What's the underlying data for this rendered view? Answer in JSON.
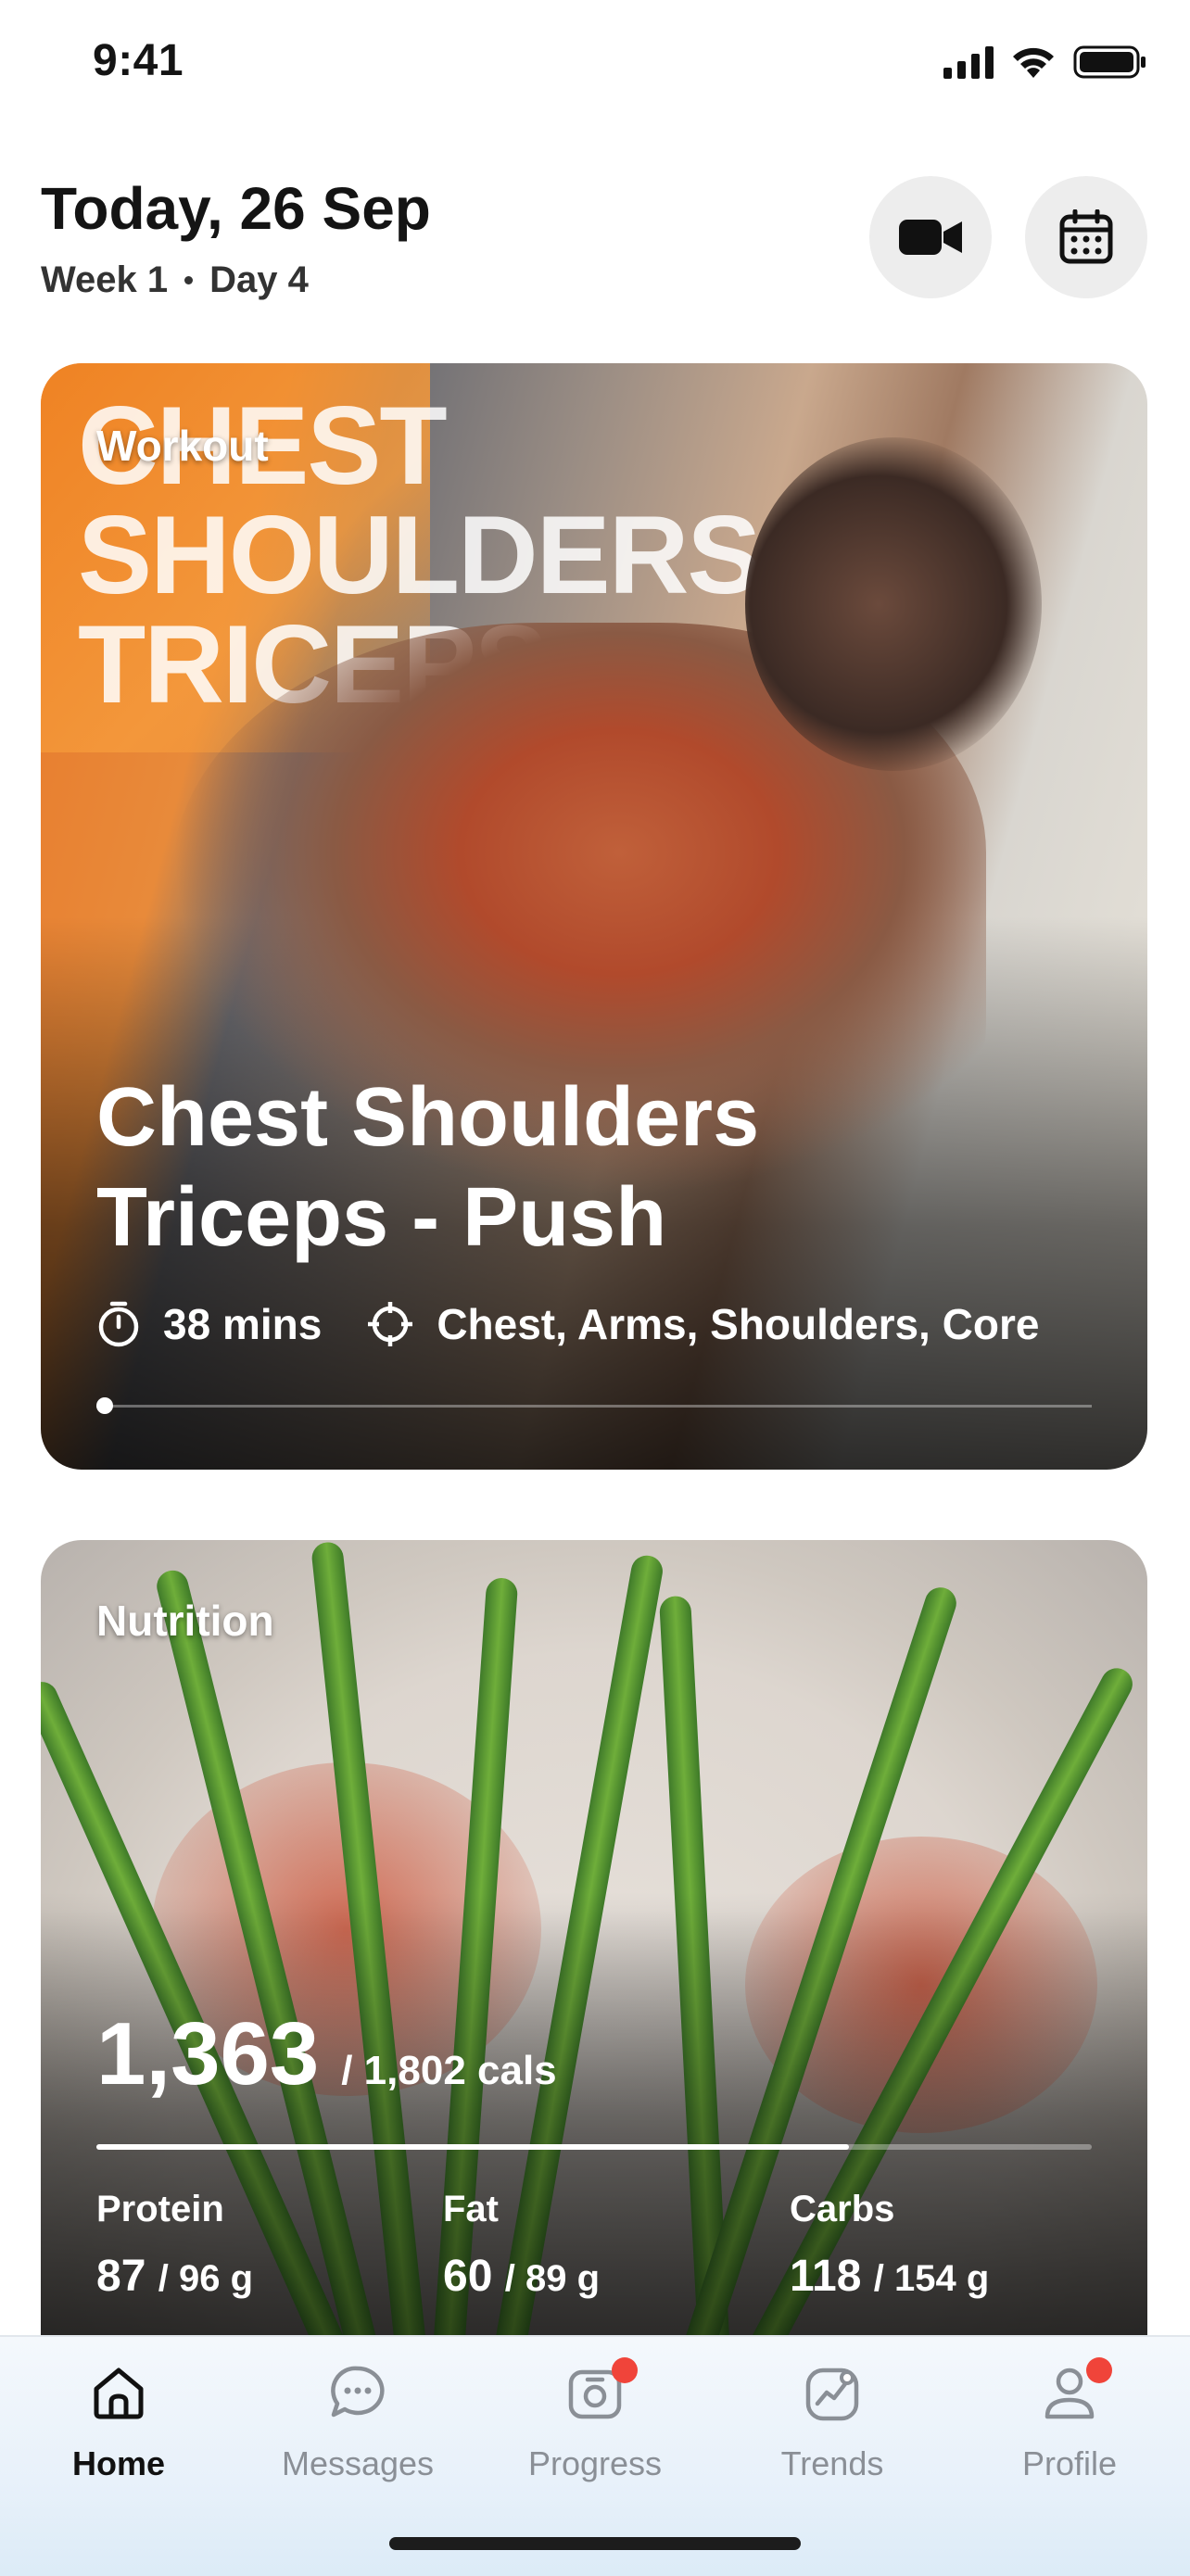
{
  "status_bar": {
    "time": "9:41"
  },
  "header": {
    "title": "Today, 26 Sep",
    "week": "Week 1",
    "day": "Day 4"
  },
  "workout_card": {
    "label": "Workout",
    "poster_text": "CHEST SHOULDERS TRICEPS",
    "title_line1": "Chest Shoulders",
    "title_line2": "Triceps - Push",
    "duration": "38 mins",
    "target": "Chest, Arms, Shoulders, Core"
  },
  "nutrition_card": {
    "label": "Nutrition",
    "calories_consumed": "1,363",
    "calories_target": "/ 1,802 cals",
    "progress_fraction": 0.756,
    "macros": [
      {
        "name": "Protein",
        "value": "87",
        "total": "/ 96 g"
      },
      {
        "name": "Fat",
        "value": "60",
        "total": "/ 89 g"
      },
      {
        "name": "Carbs",
        "value": "118",
        "total": "/ 154 g"
      }
    ]
  },
  "tabs": [
    {
      "label": "Home",
      "icon": "home-icon",
      "active": true,
      "badge": false
    },
    {
      "label": "Messages",
      "icon": "chat-icon",
      "active": false,
      "badge": false
    },
    {
      "label": "Progress",
      "icon": "camera-icon",
      "active": false,
      "badge": true
    },
    {
      "label": "Trends",
      "icon": "trend-chart-icon",
      "active": false,
      "badge": false
    },
    {
      "label": "Profile",
      "icon": "user-icon",
      "active": false,
      "badge": true
    }
  ],
  "colors": {
    "accent_badge": "#f0443a",
    "tab_active": "#111111",
    "tab_inactive": "#8a8f96"
  }
}
